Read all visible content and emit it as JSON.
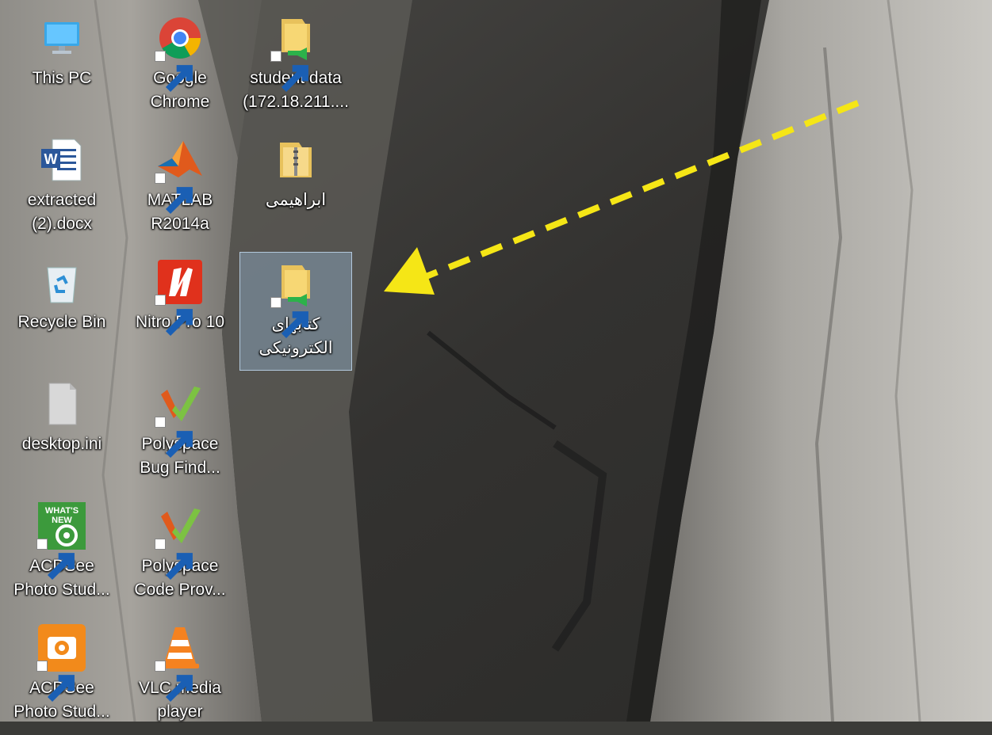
{
  "desktop": {
    "icons": [
      {
        "label": "This PC",
        "icon": "this-pc-icon"
      },
      {
        "label": "Google\nChrome",
        "icon": "chrome-icon"
      },
      {
        "label": "student data\n(172.18.211....",
        "icon": "network-folder-icon"
      },
      {
        "label": "extracted\n(2).docx",
        "icon": "word-document-icon"
      },
      {
        "label": "MATLAB\nR2014a",
        "icon": "matlab-icon"
      },
      {
        "label": "ابراهیمی",
        "icon": "zip-folder-icon"
      },
      {
        "label": "Recycle Bin",
        "icon": "recycle-bin-icon"
      },
      {
        "label": "Nitro Pro 10",
        "icon": "nitro-pro-icon"
      },
      {
        "label": "کتابهای\nالکترونیکی",
        "icon": "network-folder-icon",
        "selected": true
      },
      {
        "label": "desktop.ini",
        "icon": "ini-file-icon"
      },
      {
        "label": "Polyspace\nBug Find...",
        "icon": "polyspace-icon"
      },
      {
        "label": "ACDSee\nPhoto Stud...",
        "icon": "acdsee-whats-new-icon"
      },
      {
        "label": "Polyspace\nCode Prov...",
        "icon": "polyspace-icon"
      },
      {
        "label": "ACDSee\nPhoto Stud...",
        "icon": "acdsee-icon"
      },
      {
        "label": "VLC media\nplayer",
        "icon": "vlc-icon"
      }
    ]
  },
  "annotation": {
    "arrow_color": "#f5e616",
    "style": "dashed"
  },
  "colors": {
    "selection": "#a0c8eb"
  }
}
